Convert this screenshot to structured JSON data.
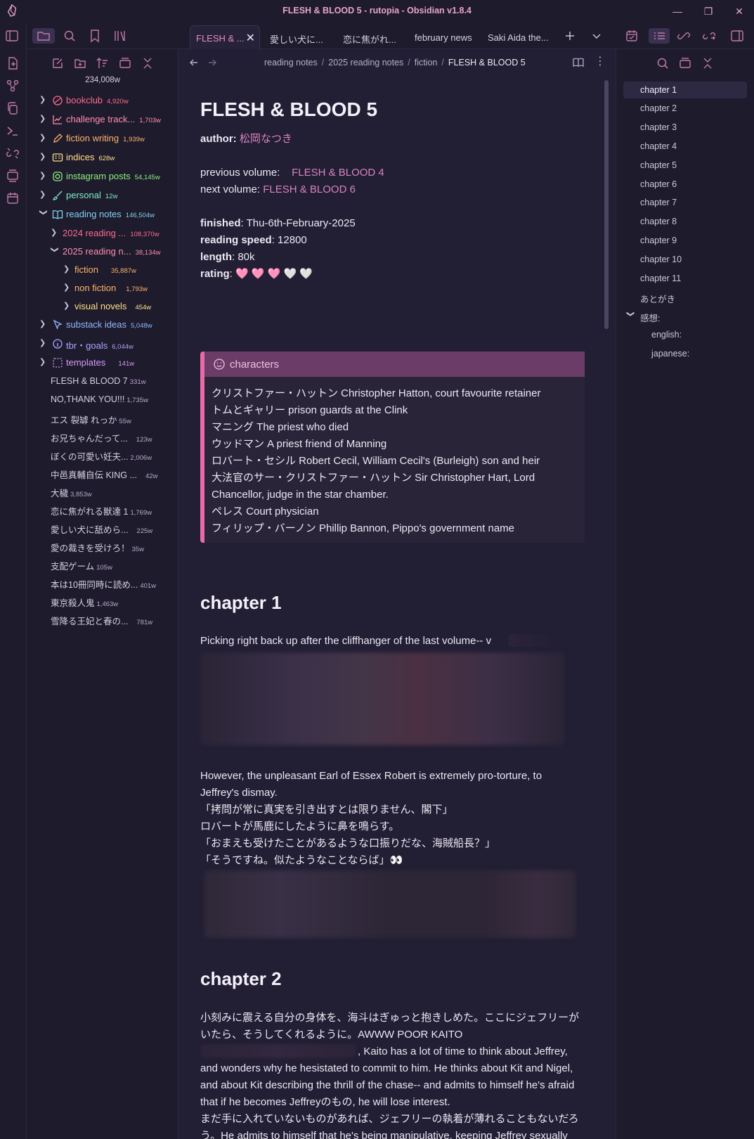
{
  "window": {
    "title": "FLESH & BLOOD 5 - rutopia - Obsidian v1.8.4",
    "controls": {
      "minimize": "—",
      "maximize": "❐",
      "close": "✕"
    }
  },
  "tabs": [
    {
      "label": "FLESH & ...",
      "active": true
    },
    {
      "label": "愛しい犬に...",
      "active": false
    },
    {
      "label": "恋に焦がれ...",
      "active": false
    },
    {
      "label": "february news",
      "active": false
    },
    {
      "label": "Saki Aida the...",
      "active": false
    }
  ],
  "sidebar": {
    "word_total": "234,008w",
    "folders": [
      {
        "label": "bookclub",
        "wc": "4,920w",
        "color": "#ff6b8e",
        "icon": "bookclub-icon",
        "expanded": false,
        "level": 0
      },
      {
        "label": "challenge track...",
        "wc": "1,703w",
        "color": "#ff8fb0",
        "icon": "chart-icon",
        "expanded": false,
        "level": 0
      },
      {
        "label": "fiction writing",
        "wc": "1,939w",
        "color": "#ffb36b",
        "icon": "pen-icon",
        "expanded": false,
        "level": 0
      },
      {
        "label": "indices",
        "wc": "628w",
        "color": "#ffe08a",
        "icon": "id-card-icon",
        "expanded": false,
        "level": 0
      },
      {
        "label": "instagram posts",
        "wc": "54,145w",
        "color": "#8ef07f",
        "icon": "instagram-icon",
        "expanded": false,
        "level": 0
      },
      {
        "label": "personal",
        "wc": "12w",
        "color": "#7ff0c7",
        "icon": "brush-icon",
        "expanded": false,
        "level": 0
      },
      {
        "label": "reading notes",
        "wc": "146,504w",
        "color": "#7fd2f0",
        "icon": "book-open-icon",
        "expanded": true,
        "level": 0
      },
      {
        "label": "2024 reading ...",
        "wc": "108,370w",
        "color": "#ff6b8e",
        "icon": "",
        "expanded": false,
        "level": 1
      },
      {
        "label": "2025 reading n...",
        "wc": "38,134w",
        "color": "#ff8fb0",
        "icon": "",
        "expanded": true,
        "level": 1
      },
      {
        "label": "fiction",
        "wc": "35,887w",
        "color": "#ffb36b",
        "icon": "",
        "expanded": false,
        "level": 2
      },
      {
        "label": "non fiction",
        "wc": "1,793w",
        "color": "#ffb36b",
        "icon": "",
        "expanded": false,
        "level": 2
      },
      {
        "label": "visual novels",
        "wc": "454w",
        "color": "#ffe08a",
        "icon": "",
        "expanded": false,
        "level": 2
      },
      {
        "label": "substack ideas",
        "wc": "5,048w",
        "color": "#8fb8ff",
        "icon": "cursor-icon",
        "expanded": false,
        "level": 0
      },
      {
        "label": "tbr・goals",
        "wc": "6,044w",
        "color": "#a9a5ff",
        "icon": "info-icon",
        "expanded": false,
        "level": 0
      },
      {
        "label": "templates",
        "wc": "141w",
        "color": "#d69bff",
        "icon": "dashed-square-icon",
        "expanded": false,
        "level": 0
      }
    ],
    "files": [
      {
        "label": "FLESH & BLOOD 7",
        "wc": "331w"
      },
      {
        "label": "NO,THANK YOU!!!",
        "wc": "1,735w"
      },
      {
        "label": "エス 裂罅 れっか",
        "wc": "55w"
      },
      {
        "label": "お兄ちゃんだって...",
        "wc": "123w"
      },
      {
        "label": "ぼくの可愛い妊夫...",
        "wc": "2,006w"
      },
      {
        "label": "中邑真輔自伝 KING ...",
        "wc": "42w"
      },
      {
        "label": "大穢",
        "wc": "3,853w"
      },
      {
        "label": "恋に焦がれる獣達 1",
        "wc": "1,769w"
      },
      {
        "label": "愛しい犬に舐めら...",
        "wc": "225w"
      },
      {
        "label": "愛の裁きを受けろ！",
        "wc": "35w"
      },
      {
        "label": "支配ゲーム",
        "wc": "105w"
      },
      {
        "label": "本は10冊同時に読め...",
        "wc": "401w"
      },
      {
        "label": "東京殺人鬼",
        "wc": "1,463w"
      },
      {
        "label": "雪降る王妃と春の...",
        "wc": "781w"
      }
    ]
  },
  "breadcrumb": [
    "reading notes",
    "2025 reading notes",
    "fiction",
    "FLESH & BLOOD 5"
  ],
  "note": {
    "title": "FLESH & BLOOD 5",
    "author_label": "author:",
    "author": "松岡なつき",
    "previous_label": "previous volume:",
    "previous": "FLESH & BLOOD 4",
    "next_label": "next volume:",
    "next": "FLESH & BLOOD 6",
    "finished_label": "finished",
    "finished": ": Thu-6th-February-2025",
    "speed_label": "reading speed",
    "speed": ": 12800",
    "length_label": "length",
    "length": ": 80k",
    "rating_label": "rating",
    "rating": ": 🩷 🩷 🩷 🤍 🤍",
    "callout_title": "characters",
    "characters": [
      "クリストファー・ハットン Christopher Hatton, court favourite retainer",
      "トムとギャリー prison guards at the Clink",
      "マニング The priest who died",
      "ウッドマン A priest friend of Manning",
      "ロバート・セシル Robert Cecil, William Cecil's (Burleigh) son and heir",
      "大法官のサー・クリストファー・ハットン Sir Christopher Hart, Lord Chancellor, judge in the star chamber.",
      "ペレス Court physician",
      "フィリップ・バーノン Phillip Bannon, Pippo's government name"
    ],
    "ch1_heading": "chapter 1",
    "ch1_p1": "Picking right back up after the cliffhanger of the last volume-- v",
    "ch1_p2": "However, the unpleasant Earl of Essex Robert is extremely pro-torture, to Jeffrey's dismay.",
    "ch1_q1": "「拷問が常に真実を引き出すとは限りません、閣下」",
    "ch1_q2": "ロバートが馬鹿にしたように鼻を鳴らす。",
    "ch1_q3": "「おまえも受けたことがあるような口振りだな、海賊船長？」",
    "ch1_q4": "「そうですね。似たようなことならば」👀",
    "ch2_heading": "chapter 2",
    "ch2_p1": "小刻みに震える自分の身体を、海斗はぎゅっと抱きしめた。ここにジェフリーがいたら、そうしてくれるように。AWWW POOR KAITO",
    "ch2_p2": ", Kaito has a lot of time to think about Jeffrey, and wonders why he hesistated to commit to him. He thinks about Kit and Nigel, and about Kit describing the thrill of the chase-- and admits to himself he's afraid that if he becomes Jeffreyのもの, he will lose interest.",
    "ch2_p3": "まだ手に入れていないものがあれば、ジェフリーの執着が薄れることもないだろう。He admits to himself that he's being manipulative, keeping Jeffrey sexually frustrated to assure his own position."
  },
  "outline": [
    "chapter 1",
    "chapter 2",
    "chapter 3",
    "chapter 4",
    "chapter 5",
    "chapter 6",
    "chapter 7",
    "chapter 8",
    "chapter 9",
    "chapter 10",
    "chapter 11",
    "あとがき",
    "感想:",
    "english:",
    "japanese:"
  ],
  "colors": {
    "accent": "#e78bc4",
    "background": "#1e1b2c",
    "editor": "#221e33",
    "callout_border": "#e86aa9",
    "callout_head": "#6b3c68"
  }
}
